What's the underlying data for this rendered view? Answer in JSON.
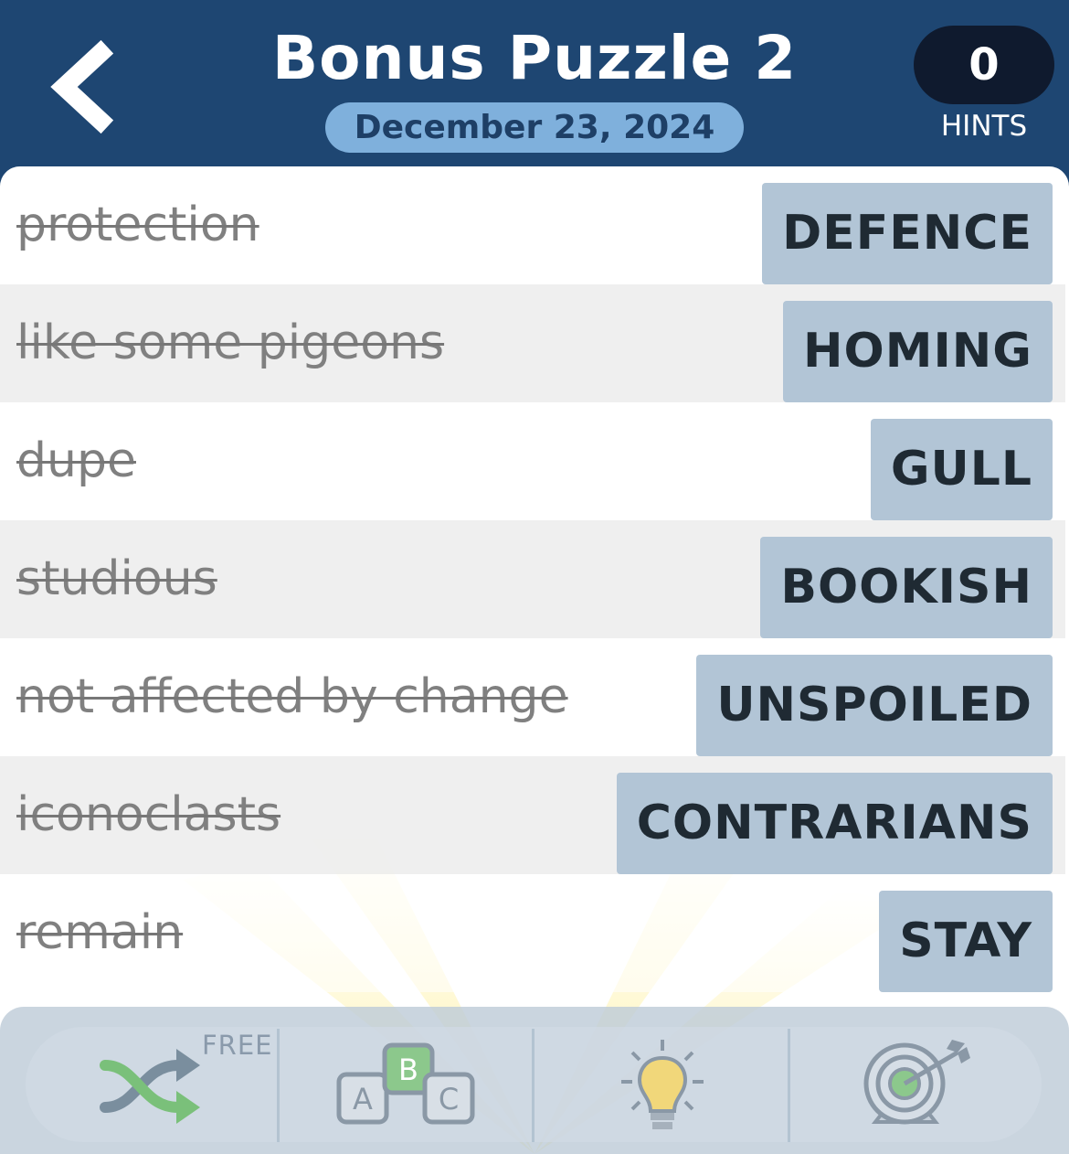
{
  "header": {
    "title": "Bonus Puzzle 2",
    "date": "December 23, 2024",
    "hints_count": "0",
    "hints_label": "HINTS"
  },
  "rows": [
    {
      "clue": "protection",
      "answer": "DEFENCE"
    },
    {
      "clue": "like some pigeons",
      "answer": "HOMING"
    },
    {
      "clue": "dupe",
      "answer": "GULL"
    },
    {
      "clue": "studious",
      "answer": "BOOKISH"
    },
    {
      "clue": "not affected by change",
      "answer": "UNSPOILED"
    },
    {
      "clue": "iconoclasts",
      "answer": "CONTRARIANS"
    },
    {
      "clue": "remain",
      "answer": "STAY"
    }
  ],
  "toolbar": {
    "free_label": "FREE",
    "tools": [
      {
        "icon": "shuffle-icon"
      },
      {
        "icon": "abc-blocks-icon",
        "letters": [
          "A",
          "B",
          "C"
        ]
      },
      {
        "icon": "lightbulb-icon"
      },
      {
        "icon": "target-icon"
      }
    ]
  },
  "colors": {
    "header_bg": "#1e4672",
    "date_pill": "#7fb0dc",
    "hints_badge": "#0f1a2e",
    "answer_tile": "#b2c5d6",
    "clue_text": "#808080",
    "ray_yellow": "#fff3b0"
  }
}
